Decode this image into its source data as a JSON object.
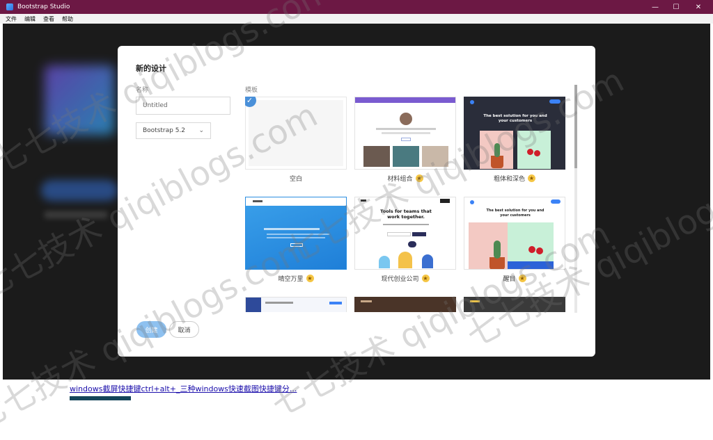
{
  "window": {
    "title": "Bootstrap Studio",
    "minimize": "—",
    "maximize": "☐",
    "close": "✕"
  },
  "menu": [
    "文件",
    "编辑",
    "查看",
    "帮助"
  ],
  "dialog": {
    "title": "新的设计",
    "name_label": "名称",
    "name_value": "Untitled",
    "version_value": "Bootstrap 5.2",
    "template_label": "模板",
    "templates": [
      {
        "label": "空白",
        "premium": false,
        "selected": true
      },
      {
        "label": "材料组合",
        "premium": true,
        "selected": false
      },
      {
        "label": "粗体和深色",
        "premium": true,
        "selected": false
      },
      {
        "label": "晴空万里",
        "premium": true,
        "selected": false
      },
      {
        "label": "现代创业公司",
        "premium": true,
        "selected": false
      },
      {
        "label": "醒目",
        "premium": true,
        "selected": false
      }
    ],
    "create_label": "创建",
    "cancel_label": "取消"
  },
  "thumbs": {
    "hero_text": "The best solution for you and your customers",
    "tools_title": "Tools for teams that work together."
  },
  "bottom_link": "windows截屏快捷键ctrl+alt+_三种windows快速截图快捷键分...",
  "watermark": "七七技术 qiqiblogs.com",
  "colors": {
    "titlebar": "#6c1844",
    "accent": "#4a90d9",
    "star": "#f5c645"
  }
}
